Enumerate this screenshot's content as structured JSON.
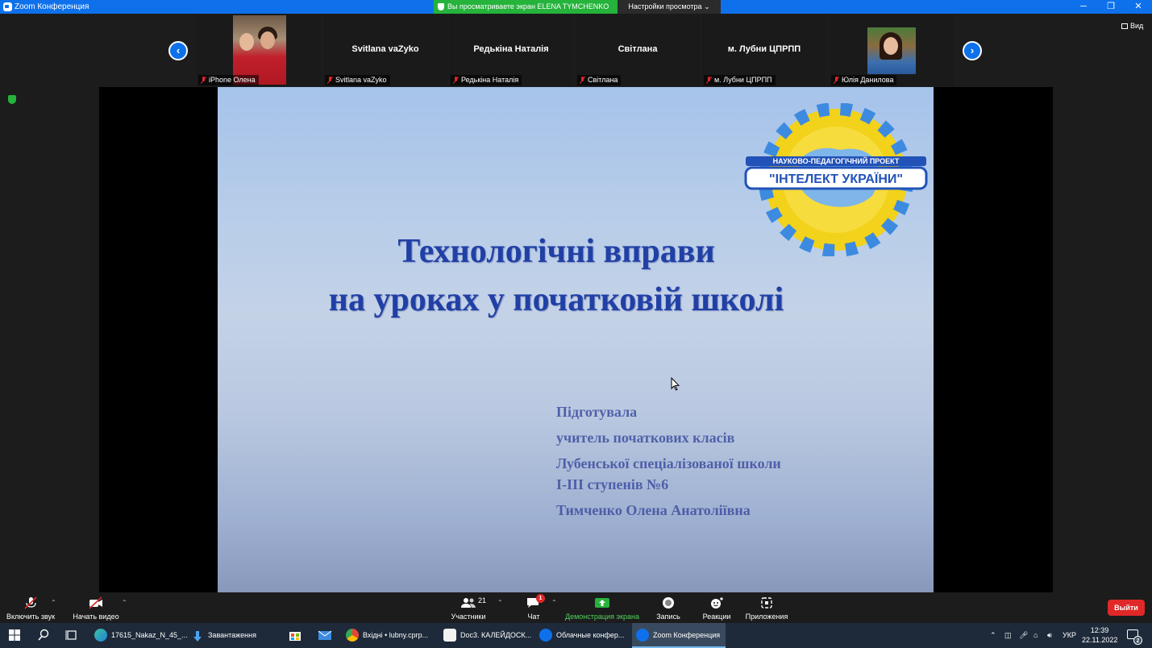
{
  "window": {
    "title": "Zoom Конференция"
  },
  "share_banner": "Вы просматриваете экран ELENA TYMCHENKO",
  "view_settings": "Настройки просмотра",
  "win_controls": {
    "minimize": "─",
    "restore": "❐",
    "close": "✕"
  },
  "view_button": "Вид",
  "participants": [
    {
      "label": "iPhone Олена",
      "big_name": ""
    },
    {
      "label": "Svitlana vaZyko",
      "big_name": "Svitlana vaZyko"
    },
    {
      "label": "Редькіна Наталія",
      "big_name": "Редькіна Наталія"
    },
    {
      "label": "Світлана",
      "big_name": "Світлана"
    },
    {
      "label": "м. Лубни ЦПРПП",
      "big_name": "м. Лубни ЦПРПП"
    },
    {
      "label": "Юлія Данилова",
      "big_name": ""
    }
  ],
  "slide": {
    "title_line1": "Технологічні вправи",
    "title_line2": "на уроках у початковій школі",
    "logo_top": "НАУКОВО-ПЕДАГОГІЧНИЙ ПРОЕКТ",
    "logo_main": "\"ІНТЕЛЕКТ УКРАЇНИ\"",
    "info": [
      "Підготувала",
      "учитель початкових класів",
      "Лубенської спеціалізованої школи",
      "І-ІІІ ступенів №6",
      "Тимченко Олена Анатоліївна"
    ]
  },
  "toolbar": {
    "audio": "Включить звук",
    "video": "Начать видео",
    "participants": "Участники",
    "participants_count": "21",
    "chat": "Чат",
    "chat_badge": "1",
    "share": "Демонстрация экрана",
    "record": "Запись",
    "reactions": "Реакции",
    "apps": "Приложения",
    "leave": "Выйти"
  },
  "taskbar": {
    "apps": [
      "17615_Nakaz_N_45_...",
      "Завантаження",
      "Вхідні • lubny.cprp...",
      "Doc3. КАЛЕЙДОСК...",
      "Облачные конфер...",
      "Zoom Конференция"
    ],
    "lang": "УКР",
    "time": "12:39",
    "date": "22.11.2022",
    "notif_count": "2"
  },
  "colors": {
    "zoom_blue": "#0e71eb",
    "share_green": "#25b33b",
    "leave_red": "#e02828",
    "slide_title": "#2140a6"
  }
}
